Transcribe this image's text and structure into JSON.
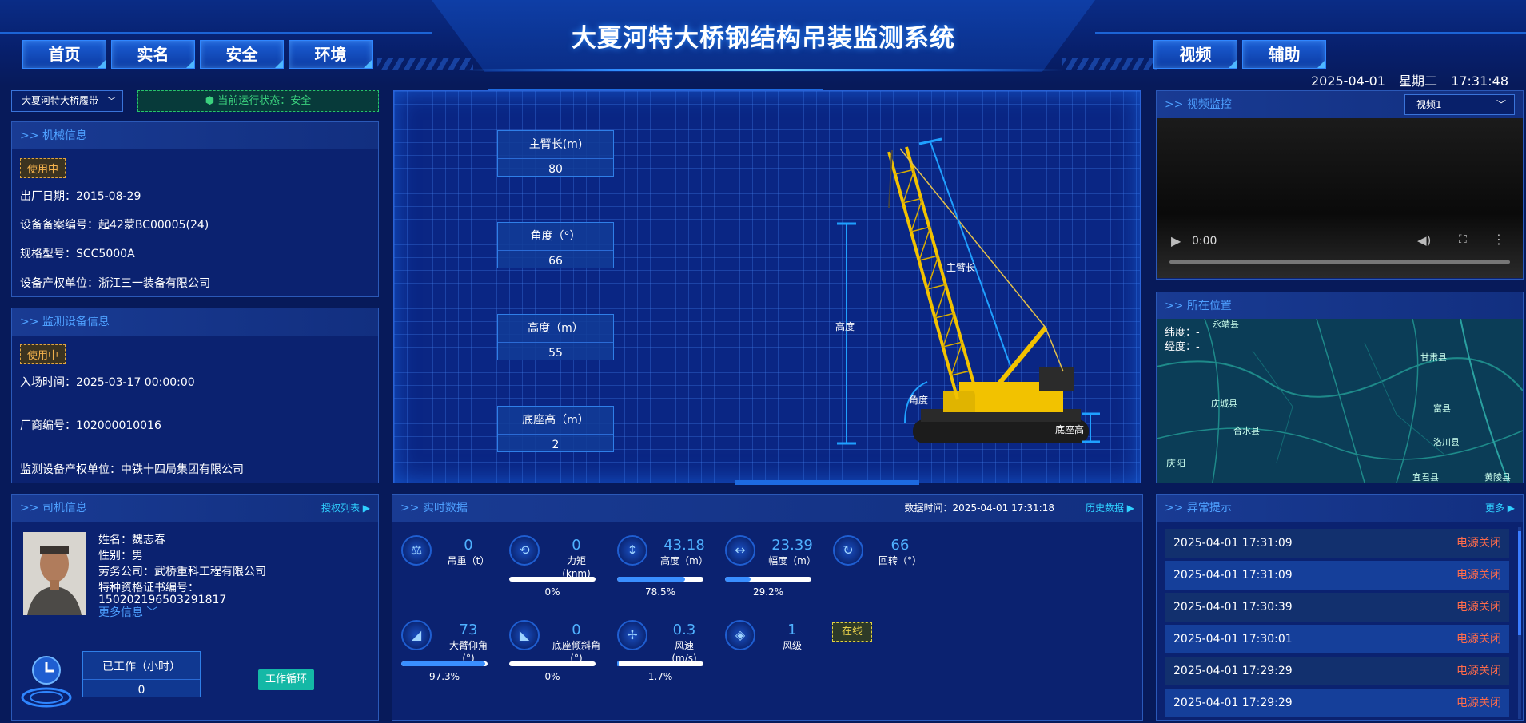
{
  "header": {
    "title": "大夏河特大桥钢结构吊装监测系统",
    "nav_left": [
      "首页",
      "实名",
      "安全",
      "环境"
    ],
    "nav_right": [
      "视频",
      "辅助"
    ],
    "date": "2025-04-01",
    "weekday": "星期二",
    "time": "17:31:48"
  },
  "site_select": {
    "value": "大夏河特大桥履带"
  },
  "run_status": {
    "label": "当前运行状态：安全"
  },
  "machine_info": {
    "title": ">> 机械信息",
    "status": "使用中",
    "lines": [
      "出厂日期：2015-08-29",
      "设备备案编号：起42蒙BC00005(24)",
      "规格型号：SCC5000A",
      "设备产权单位：浙江三一装备有限公司"
    ]
  },
  "monitor_info": {
    "title": ">> 监测设备信息",
    "status": "使用中",
    "lines": [
      "入场时间：2025-03-17 00:00:00",
      "厂商编号：102000010016",
      "监测设备产权单位：中铁十四局集团有限公司"
    ]
  },
  "driver_info": {
    "title": ">> 司机信息",
    "more": "授权列表 ▶",
    "lines": [
      "姓名：魏志春",
      "性别：男",
      "劳务公司：武桥重科工程有限公司",
      "特种资格证书编号：",
      "150202196503291817"
    ],
    "more_info": "更多信息",
    "worked_label": "已工作（小时）",
    "worked_value": "0",
    "cycle_button": "工作循环"
  },
  "crane": {
    "params": [
      {
        "label": "主臂长(m)",
        "value": "80"
      },
      {
        "label": "角度（°）",
        "value": "66"
      },
      {
        "label": "高度（m）",
        "value": "55"
      },
      {
        "label": "底座高（m）",
        "value": "2"
      }
    ],
    "labels": {
      "boom": "主臂长",
      "height": "高度",
      "angle": "角度",
      "base": "底座高"
    }
  },
  "realtime": {
    "title": ">> 实时数据",
    "data_time_label": "数据时间：",
    "data_time": "2025-04-01 17:31:18",
    "history": "历史数据 ▶",
    "online": "在线",
    "metrics": [
      {
        "value": "0",
        "label": "吊重（t）",
        "unit_line": "",
        "icon": "weight-icon",
        "glyph": "⚖",
        "pct": null
      },
      {
        "value": "0",
        "label": "力矩",
        "unit_line": "(knm)",
        "icon": "moment-icon",
        "glyph": "⟲",
        "pct": 0,
        "pct_text": "0%"
      },
      {
        "value": "43.18",
        "label": "高度（m）",
        "unit_line": "",
        "icon": "height-icon",
        "glyph": "↕",
        "pct": 78.5,
        "pct_text": "78.5%"
      },
      {
        "value": "23.39",
        "label": "幅度（m）",
        "unit_line": "",
        "icon": "range-icon",
        "glyph": "↔",
        "pct": 29.2,
        "pct_text": "29.2%"
      },
      {
        "value": "66",
        "label": "回转（°）",
        "unit_line": "",
        "icon": "rotation-icon",
        "glyph": "↻",
        "pct": null
      },
      {
        "value": "73",
        "label": "大臂仰角",
        "unit_line": "(°)",
        "icon": "boom-angle-icon",
        "glyph": "◢",
        "pct": 97.3,
        "pct_text": "97.3%"
      },
      {
        "value": "0",
        "label": "底座倾斜角",
        "unit_line": "(°)",
        "icon": "base-tilt-icon",
        "glyph": "◣",
        "pct": 0,
        "pct_text": "0%"
      },
      {
        "value": "0.3",
        "label": "风速",
        "unit_line": "(m/s)",
        "icon": "wind-speed-icon",
        "glyph": "✢",
        "pct": 1.7,
        "pct_text": "1.7%"
      },
      {
        "value": "1",
        "label": "风级",
        "unit_line": "",
        "icon": "wind-level-icon",
        "glyph": "◈",
        "pct": null
      }
    ]
  },
  "video": {
    "title": ">> 视频监控",
    "select": "视频1",
    "time": "0:00"
  },
  "location": {
    "title": ">> 所在位置",
    "lat": "纬度：-",
    "lng": "经度：-",
    "places": [
      "永靖县",
      "甘肃县",
      "庆城县",
      "富县",
      "合水县",
      "洛川县",
      "庆阳",
      "宜君县",
      "黄陵县"
    ]
  },
  "alarms": {
    "title": ">> 异常提示",
    "more": "更多 ▶",
    "rows": [
      {
        "time": "2025-04-01 17:31:09",
        "status": "电源关闭"
      },
      {
        "time": "2025-04-01 17:31:09",
        "status": "电源关闭"
      },
      {
        "time": "2025-04-01 17:30:39",
        "status": "电源关闭"
      },
      {
        "time": "2025-04-01 17:30:01",
        "status": "电源关闭"
      },
      {
        "time": "2025-04-01 17:29:29",
        "status": "电源关闭"
      },
      {
        "time": "2025-04-01 17:29:29",
        "status": "电源关闭"
      }
    ]
  },
  "colors": {
    "accent": "#4fb1ff",
    "alarm": "#ff6b4a",
    "ok": "#3bd17e",
    "warn": "#f5b24d"
  }
}
